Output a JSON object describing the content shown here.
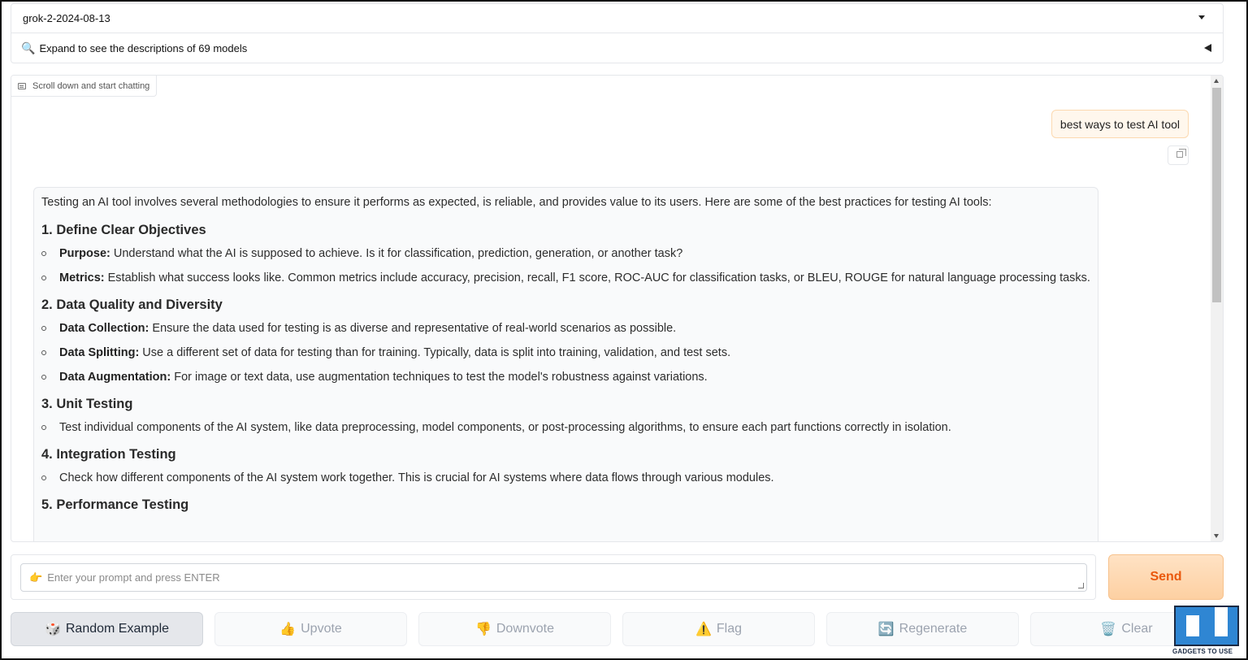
{
  "model_selector": {
    "value": "grok-2-2024-08-13"
  },
  "descriptions_toggle": {
    "icon": "magnifier-icon",
    "label": "Expand to see the descriptions of 69 models"
  },
  "chatbot": {
    "label": "Scroll down and start chatting",
    "user_message": "best ways to test AI tool",
    "bot_intro": "Testing an AI tool involves several methodologies to ensure it performs as expected, is reliable, and provides value to its users. Here are some of the best practices for testing AI tools:",
    "sections": [
      {
        "heading": "1. Define Clear Objectives",
        "items": [
          {
            "bold": "Purpose:",
            "text": " Understand what the AI is supposed to achieve. Is it for classification, prediction, generation, or another task?"
          },
          {
            "bold": "Metrics:",
            "text": " Establish what success looks like. Common metrics include accuracy, precision, recall, F1 score, ROC-AUC for classification tasks, or BLEU, ROUGE for natural language processing tasks."
          }
        ]
      },
      {
        "heading": "2. Data Quality and Diversity",
        "items": [
          {
            "bold": "Data Collection:",
            "text": " Ensure the data used for testing is as diverse and representative of real-world scenarios as possible."
          },
          {
            "bold": "Data Splitting:",
            "text": " Use a different set of data for testing than for training. Typically, data is split into training, validation, and test sets."
          },
          {
            "bold": "Data Augmentation:",
            "text": " For image or text data, use augmentation techniques to test the model's robustness against variations."
          }
        ]
      },
      {
        "heading": "3. Unit Testing",
        "items": [
          {
            "bold": "",
            "text": "Test individual components of the AI system, like data preprocessing, model components, or post-processing algorithms, to ensure each part functions correctly in isolation."
          }
        ]
      },
      {
        "heading": "4. Integration Testing",
        "items": [
          {
            "bold": "",
            "text": "Check how different components of the AI system work together. This is crucial for AI systems where data flows through various modules."
          }
        ]
      },
      {
        "heading": "5. Performance Testing",
        "items": []
      }
    ]
  },
  "prompt": {
    "placeholder": "Enter your prompt and press ENTER",
    "icon": "pointing-hand-icon"
  },
  "send_button": {
    "label": "Send",
    "color": "#ea580c"
  },
  "actions": [
    {
      "id": "random-example",
      "icon": "🎲",
      "label": "Random Example",
      "enabled": true
    },
    {
      "id": "upvote",
      "icon": "👍",
      "label": "Upvote",
      "enabled": false
    },
    {
      "id": "downvote",
      "icon": "👎",
      "label": "Downvote",
      "enabled": false
    },
    {
      "id": "flag",
      "icon": "⚠️",
      "label": "Flag",
      "enabled": false
    },
    {
      "id": "regenerate",
      "icon": "🔄",
      "label": "Regenerate",
      "enabled": false
    },
    {
      "id": "clear",
      "icon": "🗑️",
      "label": "Clear",
      "enabled": false
    }
  ],
  "watermark": {
    "text": "GADGETS TO USE"
  }
}
